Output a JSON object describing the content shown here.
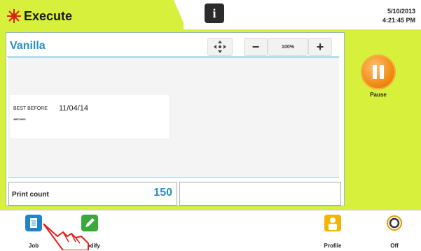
{
  "header": {
    "title": "Execute",
    "info_glyph": "i",
    "date": "5/10/2013",
    "time": "4:21:45 PM"
  },
  "job": {
    "name": "Vanilla",
    "zoom": "100%"
  },
  "label": {
    "best_before_text": "BEST BEFORE",
    "best_before_date": "11/04/14",
    "code": "ABC0000"
  },
  "print_count": {
    "label": "Print count",
    "value": "150"
  },
  "controls": {
    "pause_label": "Pause"
  },
  "bottom_nav": {
    "job": "Job",
    "modify": "Modify",
    "profile": "Profile",
    "off": "Off"
  },
  "colors": {
    "accent": "#d6f03b",
    "title_blue": "#2a8fc4",
    "pause_orange": "#f08a10"
  },
  "icons": [
    "laser-burst-icon",
    "info-icon",
    "move-icon",
    "zoom-out-icon",
    "zoom-in-icon",
    "pause-icon",
    "job-icon",
    "modify-icon",
    "profile-icon",
    "power-off-icon",
    "hand-pointer-icon"
  ]
}
